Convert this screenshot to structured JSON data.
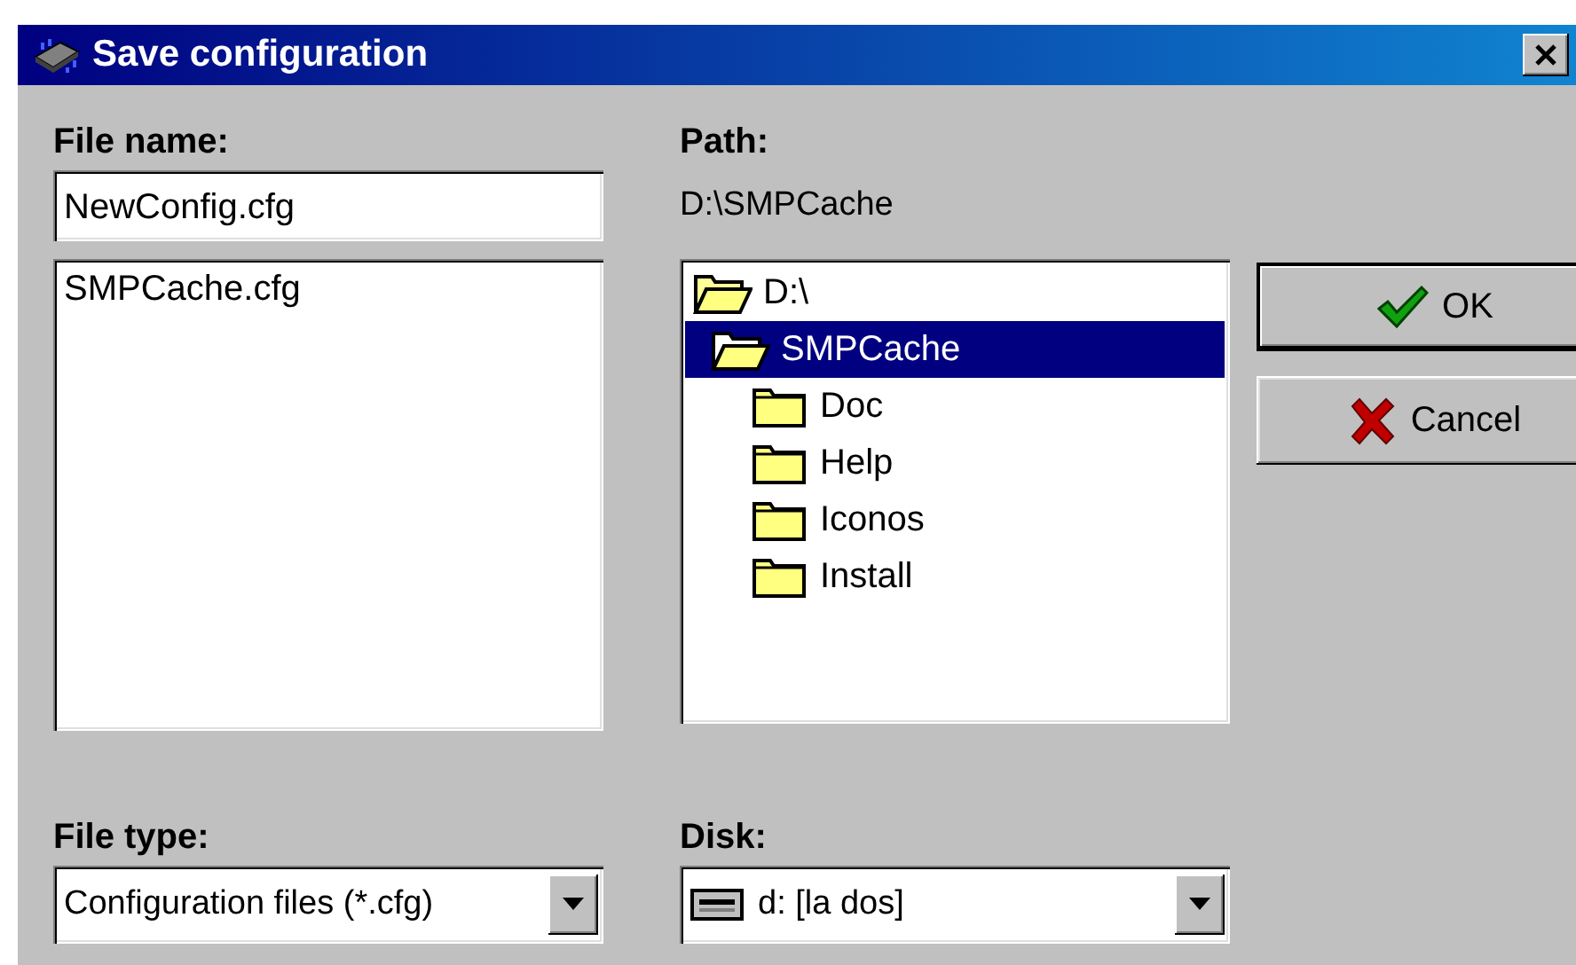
{
  "window": {
    "title": "Save configuration"
  },
  "file_name": {
    "label": "File name:",
    "value": "NewConfig.cfg"
  },
  "files": [
    {
      "name": "SMPCache.cfg",
      "selected": false
    }
  ],
  "path": {
    "label": "Path:",
    "value": "D:\\SMPCache"
  },
  "folders": [
    {
      "name": "D:\\",
      "expanded": true,
      "selected": false,
      "children": [
        {
          "name": "SMPCache",
          "expanded": true,
          "selected": true,
          "children": [
            {
              "name": "Doc",
              "expanded": false,
              "selected": false
            },
            {
              "name": "Help",
              "expanded": false,
              "selected": false
            },
            {
              "name": "Iconos",
              "expanded": false,
              "selected": false
            },
            {
              "name": "Install",
              "expanded": false,
              "selected": false
            }
          ]
        }
      ]
    }
  ],
  "buttons": [
    {
      "label": "OK",
      "kind": "ok",
      "default": true
    },
    {
      "label": "Cancel",
      "kind": "cancel",
      "default": false
    }
  ],
  "file_type": {
    "label": "File type:",
    "value": "Configuration files (*.cfg)"
  },
  "disk": {
    "label": "Disk:",
    "value": "d: [la dos]"
  }
}
